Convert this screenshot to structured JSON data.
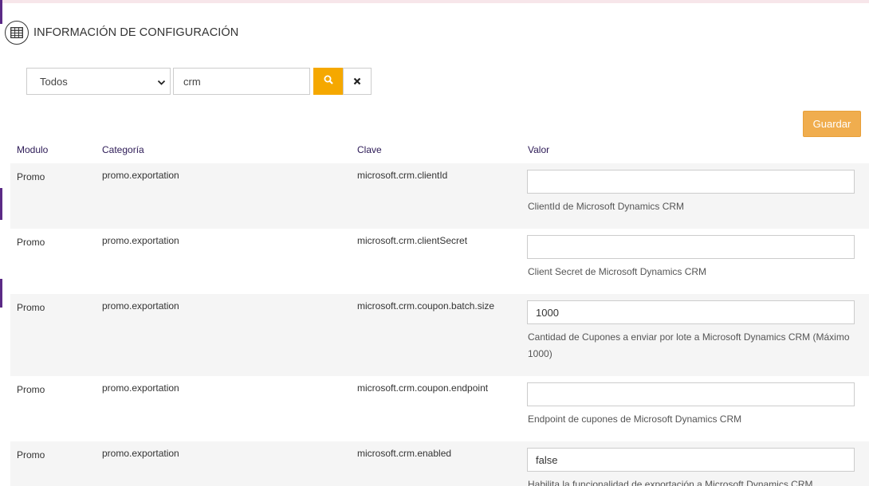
{
  "header": {
    "title": "INFORMACIÓN DE CONFIGURACIÓN",
    "icon": "table-icon"
  },
  "filters": {
    "module_selected": "Todos",
    "search_value": "crm",
    "search_icon": "search-icon",
    "clear_icon": "close-icon"
  },
  "actions": {
    "save_label": "Guardar"
  },
  "colors": {
    "accent": "#f5a800",
    "save": "#f0ad4e",
    "header_text": "#2c1a56",
    "left_accent": "#5b2a86",
    "row_shade": "#f5f5f5"
  },
  "table": {
    "columns": [
      "Modulo",
      "Categoría",
      "Clave",
      "Valor"
    ],
    "rows": [
      {
        "module": "Promo",
        "category": "promo.exportation",
        "key": "microsoft.crm.clientId",
        "value": "",
        "description": "ClientId de Microsoft Dynamics CRM"
      },
      {
        "module": "Promo",
        "category": "promo.exportation",
        "key": "microsoft.crm.clientSecret",
        "value": "",
        "description": "Client Secret de Microsoft Dynamics CRM"
      },
      {
        "module": "Promo",
        "category": "promo.exportation",
        "key": "microsoft.crm.coupon.batch.size",
        "value": "1000",
        "description": "Cantidad de Cupones a enviar por lote a Microsoft Dynamics CRM (Máximo 1000)"
      },
      {
        "module": "Promo",
        "category": "promo.exportation",
        "key": "microsoft.crm.coupon.endpoint",
        "value": "",
        "description": "Endpoint de cupones de Microsoft Dynamics CRM"
      },
      {
        "module": "Promo",
        "category": "promo.exportation",
        "key": "microsoft.crm.enabled",
        "value": "false",
        "description": "Habilita la funcionalidad de exportación a Microsoft Dynamics CRM"
      }
    ]
  }
}
